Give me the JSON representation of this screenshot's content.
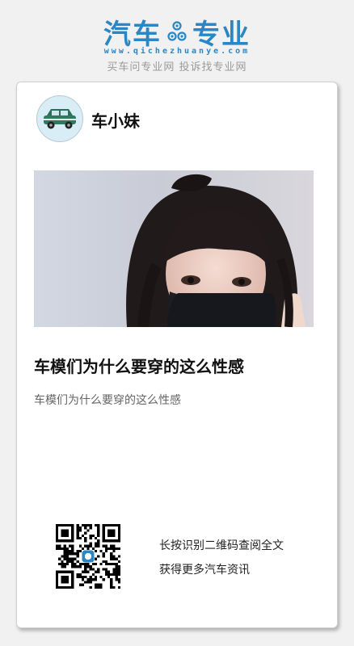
{
  "brand": {
    "name_left": "汽车",
    "name_right": "专业",
    "url": "www.qichezhuanye.com",
    "slogan": "买车问专业网 投诉找专业网",
    "color": "#2a86c4"
  },
  "article": {
    "author": "车小妹",
    "avatar_icon": "car-icon",
    "title": "车模们为什么要穿的这么性感",
    "summary": "车模们为什么要穿的这么性感"
  },
  "footer": {
    "qr_icon": "qr-code-icon",
    "line1": "长按识别二维码查阅全文",
    "line2": "获得更多汽车资讯"
  }
}
